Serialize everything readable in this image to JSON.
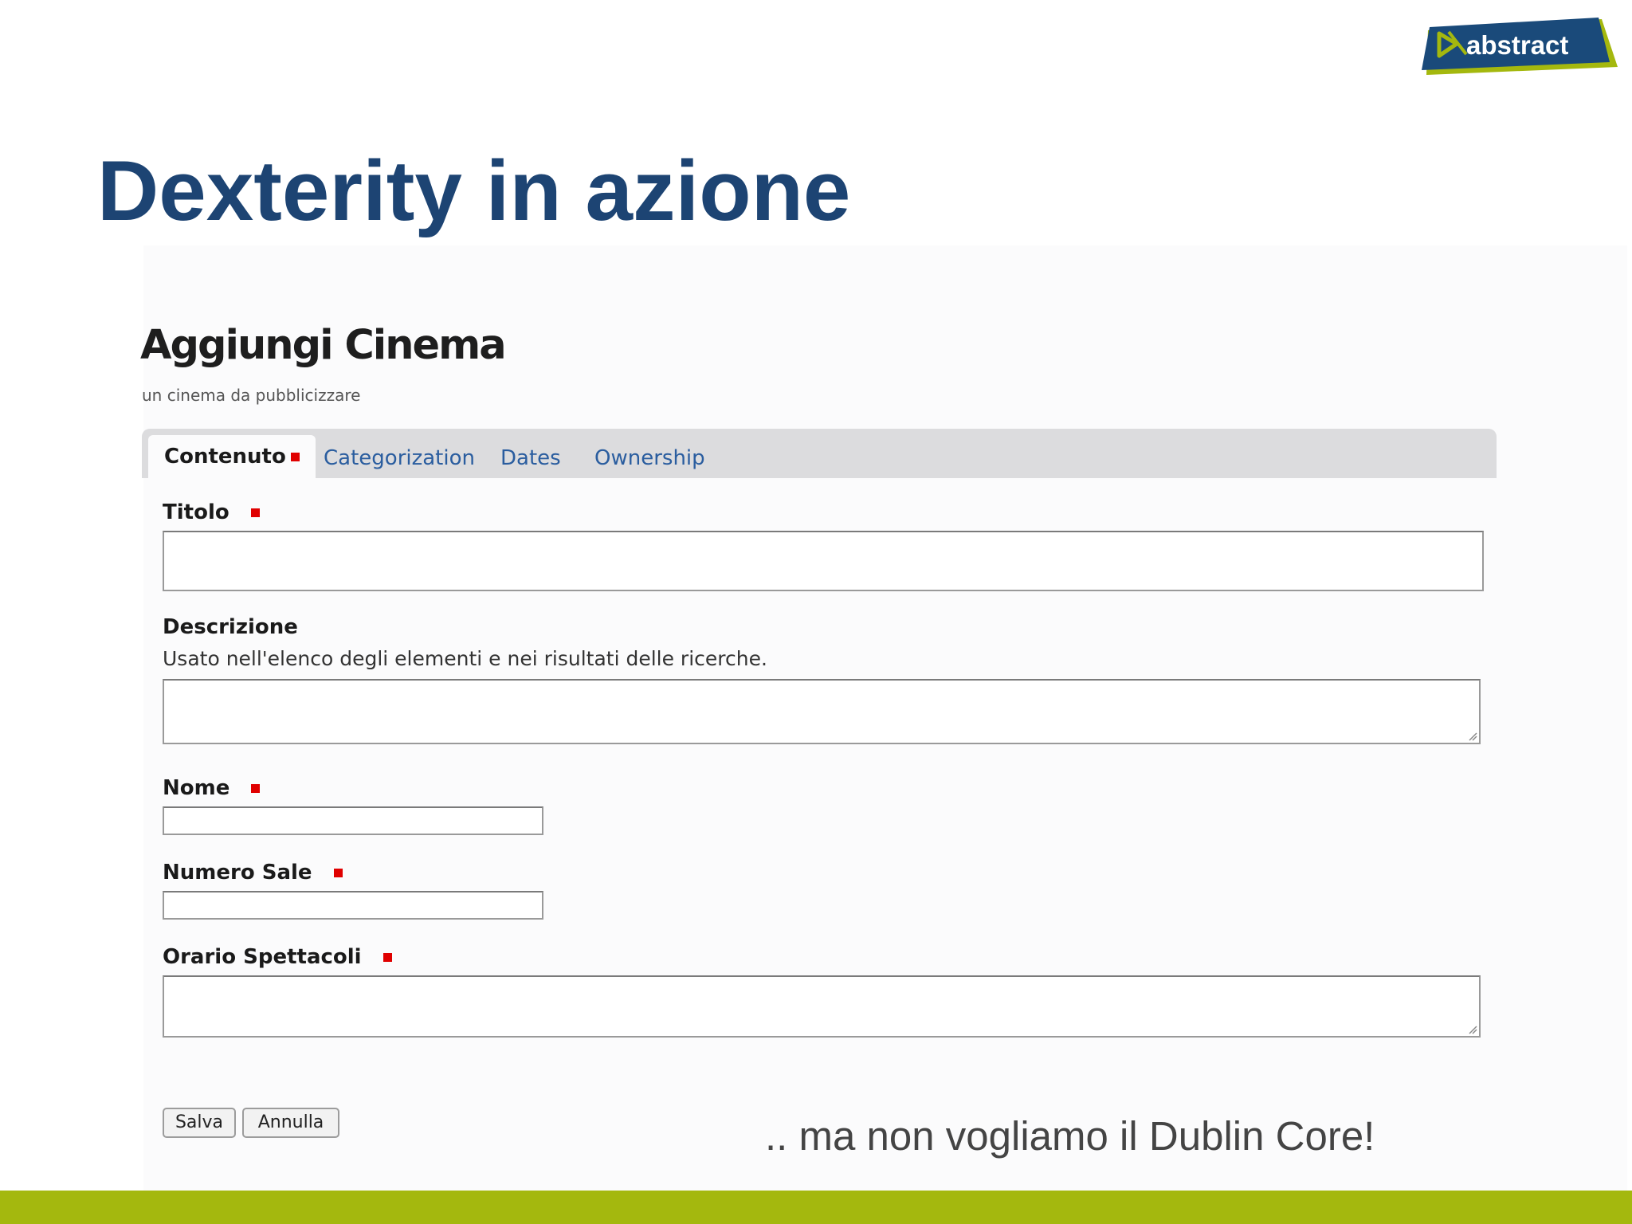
{
  "logo": {
    "text": "abstract"
  },
  "slide": {
    "title": "Dexterity in azione",
    "caption": ".. ma non vogliamo il Dublin Core!"
  },
  "form": {
    "heading": "Aggiungi Cinema",
    "subtitle": "un cinema da pubblicizzare",
    "tabs": [
      {
        "label": "Contenuto",
        "active": true,
        "required": true
      },
      {
        "label": "Categorization",
        "active": false
      },
      {
        "label": "Dates",
        "active": false
      },
      {
        "label": "Ownership",
        "active": false
      }
    ],
    "fields": {
      "titolo": {
        "label": "Titolo",
        "required": true,
        "value": ""
      },
      "descrizione": {
        "label": "Descrizione",
        "help": "Usato nell'elenco degli elementi e nei risultati delle ricerche.",
        "value": ""
      },
      "nome": {
        "label": "Nome",
        "required": true,
        "value": ""
      },
      "numero_sale": {
        "label": "Numero Sale",
        "required": true,
        "value": ""
      },
      "orario_spettacoli": {
        "label": "Orario Spettacoli",
        "required": true,
        "value": ""
      }
    },
    "buttons": {
      "save": "Salva",
      "cancel": "Annulla"
    }
  },
  "colors": {
    "title": "#1d4473",
    "tab_link": "#2a5d9f",
    "required_marker": "#e00000",
    "footer_bar": "#a4b80e",
    "logo_blue": "#1a4a7a",
    "logo_green": "#a4b80e"
  }
}
